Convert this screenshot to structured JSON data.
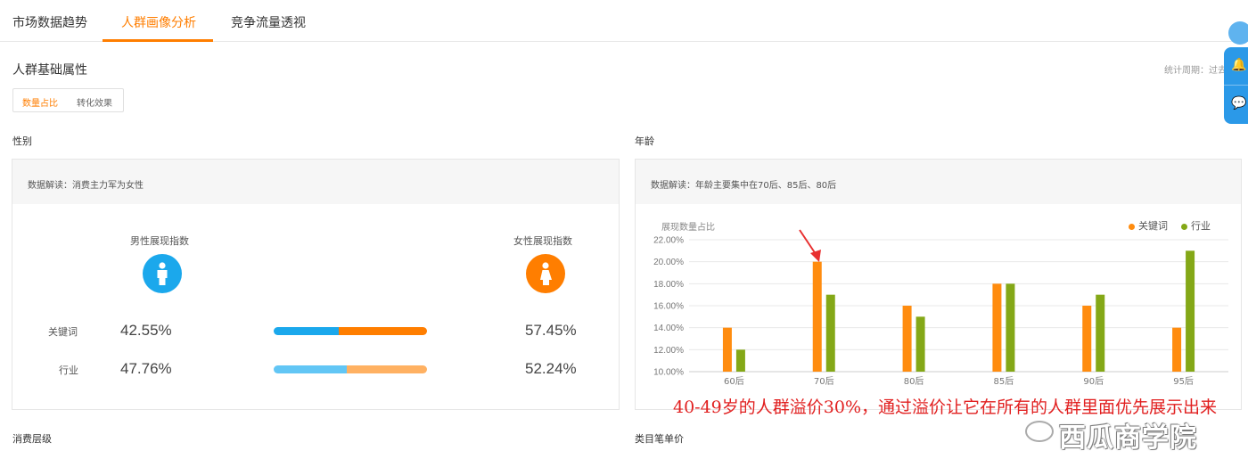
{
  "tabs": [
    {
      "label": "市场数据趋势"
    },
    {
      "label": "人群画像分析"
    },
    {
      "label": "竞争流量透视"
    }
  ],
  "section_title": "人群基础属性",
  "period_label": "统计周期：过去",
  "toggle": {
    "option1": "数量占比",
    "option2": "转化效果"
  },
  "gender": {
    "title": "性别",
    "insight": "数据解读：消费主力军为女性",
    "male_label": "男性展现指数",
    "female_label": "女性展现指数",
    "rows": [
      {
        "label": "关键词",
        "male": "42.55%",
        "female": "57.45%",
        "male_value": 42.55
      },
      {
        "label": "行业",
        "male": "47.76%",
        "female": "52.24%",
        "male_value": 47.76
      }
    ],
    "colors": {
      "male": "#1ba8ec",
      "female": "#ff7e00",
      "male_light": "#62c6f5",
      "female_light": "#ffb162"
    }
  },
  "age": {
    "title": "年龄",
    "insight": "数据解读：年龄主要集中在70后、85后、80后",
    "ylabel": "展现数量占比",
    "legend": [
      "关键词",
      "行业"
    ],
    "ticks": [
      "22.00%",
      "20.00%",
      "18.00%",
      "16.00%",
      "14.00%",
      "12.00%",
      "10.00%"
    ]
  },
  "chart_data": {
    "type": "bar",
    "categories": [
      "60后",
      "70后",
      "80后",
      "85后",
      "90后",
      "95后"
    ],
    "series": [
      {
        "name": "关键词",
        "values": [
          14,
          20,
          16,
          18,
          16,
          14
        ],
        "color": "#ff8c0f"
      },
      {
        "name": "行业",
        "values": [
          12,
          17,
          15,
          18,
          17,
          21
        ],
        "color": "#84a817"
      }
    ],
    "ylabel": "展现数量占比",
    "ylim": [
      10,
      22
    ],
    "yunit": "%",
    "grid": true,
    "legend_position": "top-right"
  },
  "annotation": "40-49岁的人群溢价30%，通过溢价让它在所有的人群里面优先展示出来",
  "watermark": "西瓜商学院",
  "bottom": {
    "left_title": "消费层级",
    "right_title": "类目笔单价"
  }
}
